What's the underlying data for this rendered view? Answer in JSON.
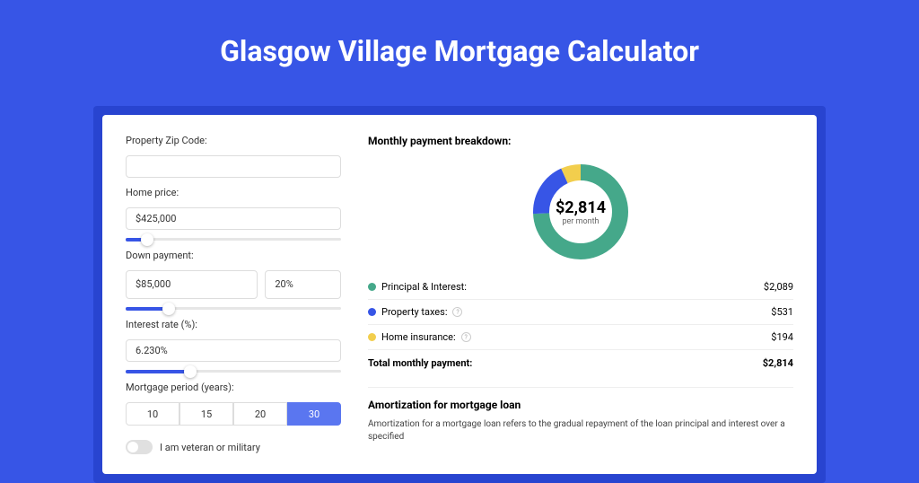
{
  "page_title": "Glasgow Village Mortgage Calculator",
  "form": {
    "zip_label": "Property Zip Code:",
    "zip_value": "",
    "home_price_label": "Home price:",
    "home_price_value": "$425,000",
    "home_price_slider_pct": 10,
    "down_label": "Down payment:",
    "down_value": "$85,000",
    "down_pct_value": "20%",
    "down_slider_pct": 20,
    "rate_label": "Interest rate (%):",
    "rate_value": "6.230%",
    "rate_slider_pct": 30,
    "period_label": "Mortgage period (years):",
    "periods": [
      "10",
      "15",
      "20",
      "30"
    ],
    "period_active": "30",
    "vet_label": "I am veteran or military"
  },
  "breakdown": {
    "title": "Monthly payment breakdown:",
    "donut_value": "$2,814",
    "donut_period": "per month",
    "items": [
      {
        "label": "Principal & Interest:",
        "value": "$2,089",
        "color": "#45a88a",
        "help": false
      },
      {
        "label": "Property taxes:",
        "value": "$531",
        "color": "#3755e6",
        "help": true
      },
      {
        "label": "Home insurance:",
        "value": "$194",
        "color": "#f2ce4d",
        "help": true
      }
    ],
    "total_label": "Total monthly payment:",
    "total_value": "$2,814"
  },
  "chart_data": {
    "type": "pie",
    "title": "Monthly payment breakdown",
    "series": [
      {
        "name": "Principal & Interest",
        "value": 2089,
        "color": "#45a88a"
      },
      {
        "name": "Property taxes",
        "value": 531,
        "color": "#3755e6"
      },
      {
        "name": "Home insurance",
        "value": 194,
        "color": "#f2ce4d"
      }
    ],
    "total": 2814
  },
  "amort": {
    "title": "Amortization for mortgage loan",
    "text": "Amortization for a mortgage loan refers to the gradual repayment of the loan principal and interest over a specified"
  }
}
